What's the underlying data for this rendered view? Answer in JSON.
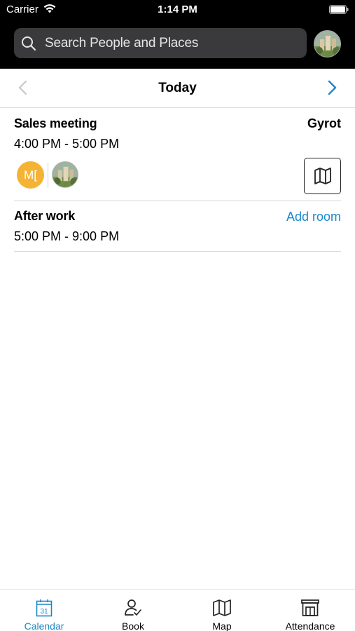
{
  "status_bar": {
    "carrier": "Carrier",
    "time": "1:14 PM",
    "icons": [
      "wifi-icon",
      "battery-icon"
    ]
  },
  "header": {
    "search_placeholder": "Search People and Places",
    "search_icon": "search-icon",
    "profile_avatar": "user-avatar-photo"
  },
  "date_nav": {
    "title": "Today",
    "prev_icon": "chevron-left-icon",
    "next_icon": "chevron-right-icon"
  },
  "events": [
    {
      "title": "Sales meeting",
      "time": "4:00 PM - 5:00 PM",
      "room": "Gyrot",
      "participants": [
        {
          "initials": "M[",
          "color": "#f5b335"
        },
        {
          "type": "photo-avatar"
        }
      ],
      "map_icon": "map-icon"
    },
    {
      "title": "After work",
      "time": "5:00 PM - 9:00 PM",
      "add_room_label": "Add room"
    }
  ],
  "tabbar": {
    "tabs": [
      {
        "label": "Calendar",
        "icon": "calendar-icon",
        "calendar_day": "31",
        "active": true
      },
      {
        "label": "Book",
        "icon": "person-check-icon",
        "active": false
      },
      {
        "label": "Map",
        "icon": "map-icon",
        "active": false
      },
      {
        "label": "Attendance",
        "icon": "building-icon",
        "active": false
      }
    ]
  },
  "colors": {
    "accent": "#1a87c9",
    "header_bg": "#000000",
    "search_bg": "#3a3a3c",
    "initials_avatar": "#f5b335"
  }
}
